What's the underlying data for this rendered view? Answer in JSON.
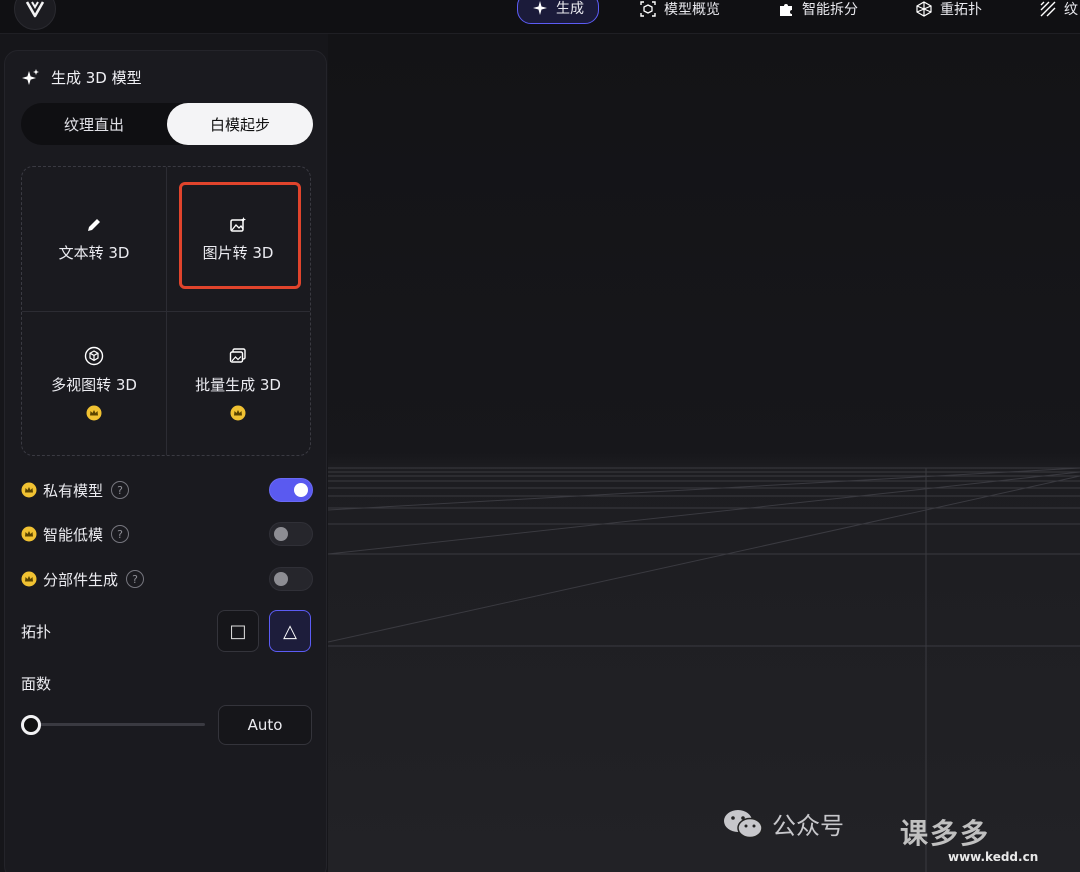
{
  "nav": {
    "items": [
      {
        "label": "生成",
        "icon": "sparkle-icon",
        "active": true
      },
      {
        "label": "模型概览",
        "icon": "cube-frame-icon",
        "active": false
      },
      {
        "label": "智能拆分",
        "icon": "puzzle-icon",
        "active": false
      },
      {
        "label": "重拓扑",
        "icon": "mesh-icon",
        "active": false
      },
      {
        "label": "纹",
        "icon": "texture-icon",
        "active": false
      }
    ]
  },
  "panel": {
    "title": "生成 3D 模型",
    "segments": [
      "纹理直出",
      "白模起步"
    ],
    "active_segment": "白模起步",
    "modes": [
      {
        "label": "文本转 3D",
        "icon": "pencil-icon",
        "premium": false
      },
      {
        "label": "图片转 3D",
        "icon": "image-icon",
        "premium": false,
        "highlighted": true
      },
      {
        "label": "多视图转 3D",
        "icon": "cube-icon",
        "premium": true
      },
      {
        "label": "批量生成 3D",
        "icon": "images-stack-icon",
        "premium": true
      }
    ],
    "options": [
      {
        "label": "私有模型",
        "help": "?",
        "enabled": true
      },
      {
        "label": "智能低模",
        "help": "?",
        "enabled": false
      },
      {
        "label": "分部件生成",
        "help": "?",
        "enabled": false
      }
    ],
    "topology": {
      "label": "拓扑",
      "choices": [
        "□",
        "△"
      ],
      "selected": "△"
    },
    "faces": {
      "label": "面数",
      "value": "Auto",
      "slider_fraction": 0
    }
  },
  "watermark": {
    "text": "公众号",
    "brand": "课多多",
    "site": "www.kedd.cn"
  },
  "colors": {
    "accent": "#5c5cf5",
    "highlight": "#e0442c",
    "crown": "#f1c232"
  }
}
